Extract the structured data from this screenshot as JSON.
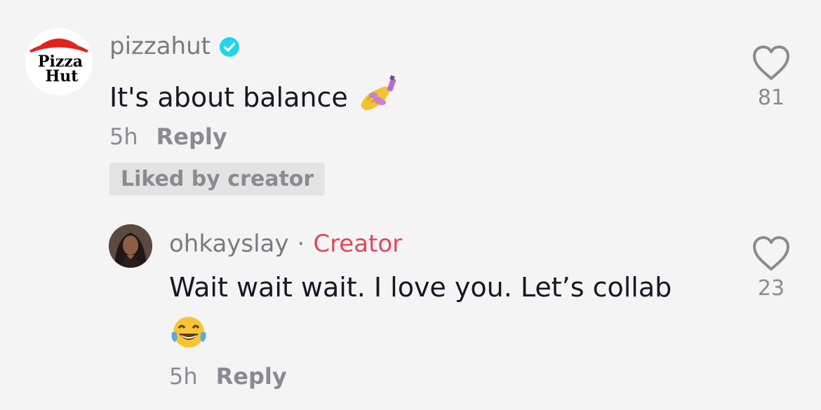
{
  "comments": [
    {
      "username": "pizzahut",
      "verified": true,
      "text": "It's about balance",
      "emoji": "nail-polish",
      "time": "5h",
      "reply_label": "Reply",
      "badge": "Liked by creator",
      "likes": "81",
      "avatar_lines": [
        "Pizza",
        "Hut"
      ]
    }
  ],
  "replies": [
    {
      "username": "ohkayslay",
      "separator": "·",
      "role": "Creator",
      "text": "Wait wait wait. I love you. Let’s collab",
      "emoji": "tears-of-joy",
      "time": "5h",
      "reply_label": "Reply",
      "likes": "23"
    }
  ],
  "colors": {
    "background": "#f4f4f4",
    "creator": "#e0475f",
    "verified": "#20d5ec",
    "pizzahut_red": "#e2231a"
  }
}
